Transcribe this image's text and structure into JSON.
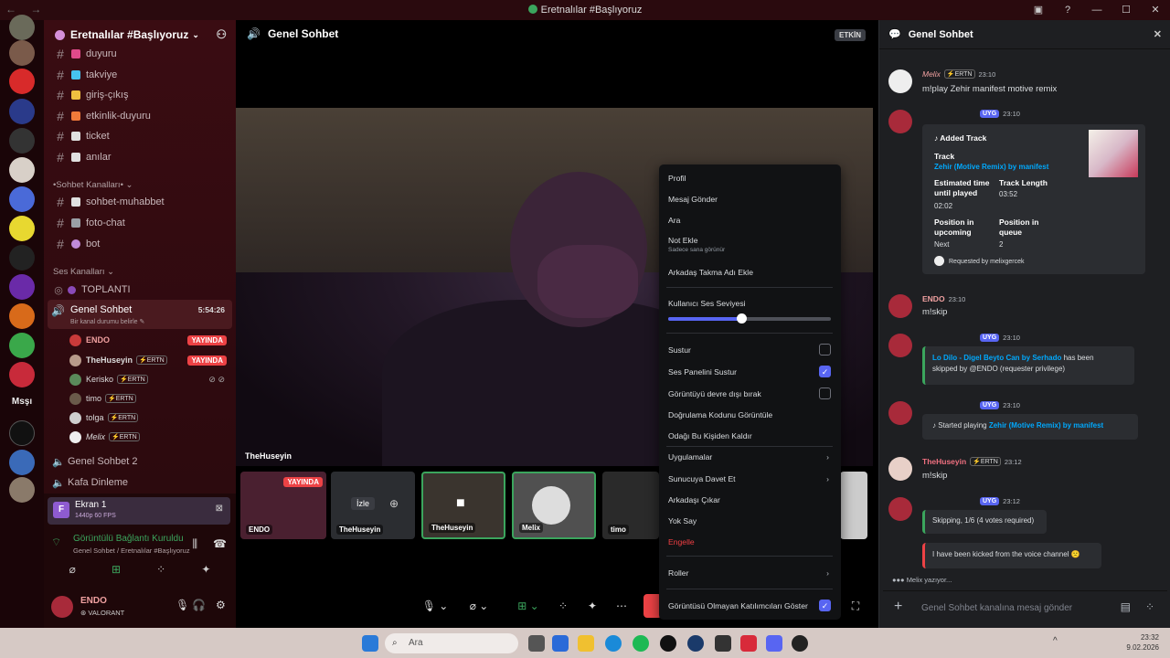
{
  "window": {
    "title": "Eretnalılar #Başlıyoruz",
    "nav": "← →"
  },
  "servers": {
    "msg_label": "Msşı"
  },
  "sidebar": {
    "guild_name": "Eretnalılar #Başlıyoruz",
    "channels": [
      {
        "label": "duyuru",
        "emoji_color": "#e04a8a"
      },
      {
        "label": "takviye",
        "emoji_color": "#46c3f0"
      },
      {
        "label": "giriş-çıkış",
        "emoji_color": "#f0c040"
      },
      {
        "label": "etkinlik-duyuru",
        "emoji_color": "#f07a3a"
      },
      {
        "label": "ticket",
        "emoji_color": "#e0e0e0"
      },
      {
        "label": "anılar",
        "emoji_color": "#e0e0e0"
      }
    ],
    "category_text": "•Sohbet Kanalları•",
    "chat_channels": [
      {
        "label": "sohbet-muhabbet",
        "emoji_color": "#e0e0e0"
      },
      {
        "label": "foto-chat",
        "emoji_color": "#9aa0a6"
      },
      {
        "label": "bot",
        "emoji_color": "#c08ad8"
      }
    ],
    "category_voice": "Ses Kanalları",
    "voice_channels": {
      "meeting": "TOPLANTI",
      "general": "Genel Sohbet",
      "general_time": "5:54:26",
      "general_status": "Bir kanal durumu belirle",
      "general2": "Genel Sohbet 2",
      "kafa": "Kafa Dinleme"
    },
    "voice_users": [
      {
        "name": "ENDO",
        "tag": "",
        "live": "YAYINDA"
      },
      {
        "name": "TheHuseyin",
        "tag": "ERTN",
        "live": "YAYINDA"
      },
      {
        "name": "Kerisko",
        "tag": "ERTN",
        "live": ""
      },
      {
        "name": "timo",
        "tag": "ERTN",
        "live": ""
      },
      {
        "name": "tolga",
        "tag": "ERTN",
        "live": ""
      },
      {
        "name": "Melix",
        "tag": "ERTN",
        "live": ""
      }
    ]
  },
  "panel": {
    "screen_title": "Ekran 1",
    "screen_sub": "1440p 60 FPS",
    "screen_icon": "F",
    "conn_title": "Görüntülü Bağlantı Kuruldu",
    "conn_sub": "Genel Sohbet / Eretnalılar #Başlıyoruz",
    "user_name": "ENDO",
    "user_activity": "VALORANT"
  },
  "stage": {
    "title": "Genel Sohbet",
    "activity_badge": "ETKİN",
    "streamer": "TheHuseyin",
    "thumbs": [
      {
        "label": "ENDO",
        "live": "YAYINDA"
      },
      {
        "label": "TheHuseyin",
        "watch": "İzle"
      },
      {
        "label": "TheHuseyin"
      },
      {
        "label": "Melix"
      },
      {
        "label": "timo"
      }
    ]
  },
  "context_menu": {
    "profile": "Profil",
    "send_message": "Mesaj Gönder",
    "call": "Ara",
    "add_note": "Not Ekle",
    "add_note_sub": "Sadece sana görünür",
    "add_nickname": "Arkadaş Takma Adı Ekle",
    "user_volume": "Kullanıcı Ses Seviyesi",
    "user_volume_level": 0.45,
    "mute": "Sustur",
    "mute_soundboard": "Ses Panelini Sustur",
    "disable_video": "Görüntüyü devre dışı bırak",
    "view_verification": "Doğrulama Kodunu Görüntüle",
    "remove_focus": "Odağı Bu Kişiden Kaldır",
    "apps": "Uygulamalar",
    "invite": "Sunucuya Davet Et",
    "remove_friend": "Arkadaşı Çıkar",
    "ignore": "Yok Say",
    "block": "Engelle",
    "roles": "Roller",
    "show_nonvideo": "Görüntüsü Olmayan Katılımcıları Göster"
  },
  "chat": {
    "title": "Genel Sohbet",
    "messages": [
      {
        "author": "Melix",
        "tag": "ERTN",
        "time": "23:10",
        "text": "m!play Zehir manifest motive remix"
      },
      {
        "badge": "UYG",
        "time": "23:10",
        "embed_title": "Added Track",
        "track_label": "Track",
        "track": "Zehir (Motive Remix) by manifest",
        "est_label": "Estimated time until played",
        "est": "02:02",
        "len_label": "Track Length",
        "len": "03:52",
        "pos_label": "Position in upcoming",
        "pos": "Next",
        "queue_label": "Position in queue",
        "queue": "2",
        "requested": "Requested by melixgercek"
      },
      {
        "author": "ENDO",
        "time": "23:10",
        "text": "m!skip"
      },
      {
        "badge": "UYG",
        "time": "23:10",
        "skipped_track": "Lo Dilo - Digel Beyto Can by Serhado",
        "skipped_rest": "has been",
        "skipped_by": "skipped by @ENDO (requester privilege)"
      },
      {
        "badge": "UYG",
        "time": "23:10",
        "started": "Started playing",
        "started_track": "Zehir (Motive Remix) by manifest"
      },
      {
        "author": "TheHuseyin",
        "tag": "ERTN",
        "time": "23:12",
        "text": "m!skip"
      },
      {
        "badge": "UYG",
        "time": "23:12",
        "skipping": "Skipping, 1/6 (4 votes required)",
        "kicked": "I have been kicked from the voice channel 🙁"
      }
    ],
    "typing": "Melix yazıyor...",
    "placeholder": "Genel Sohbet kanalına mesaj gönder"
  },
  "taskbar": {
    "search": "Ara",
    "time": "23:32",
    "date": "9.02.2026"
  },
  "colors": {
    "accent": "#5865f2",
    "live": "#ed4245",
    "online": "#3ba55d"
  }
}
